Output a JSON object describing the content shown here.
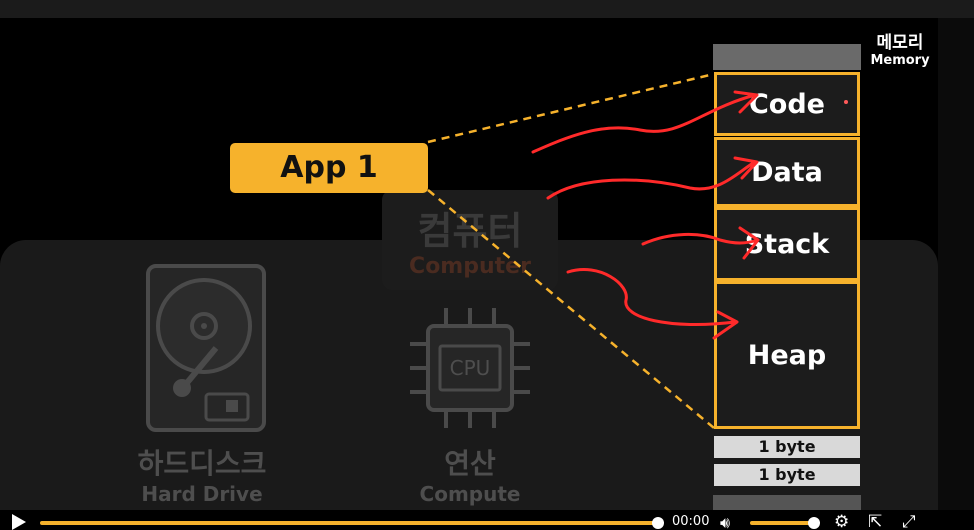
{
  "scene": {
    "computer_ko": "컴퓨터",
    "computer_en": "Computer",
    "harddisk_ko": "하드디스크",
    "harddisk_en": "Hard Drive",
    "compute_ko": "연산",
    "compute_en": "Compute",
    "cpu_chip_label": "CPU"
  },
  "app_label": "App 1",
  "memory": {
    "title_ko": "메모리",
    "title_en": "Memory",
    "segments": [
      "Code",
      "Data",
      "Stack",
      "Heap"
    ],
    "bytes": [
      "1 byte",
      "1 byte"
    ]
  },
  "player": {
    "time": "00:00",
    "progress": 1.0,
    "volume": 0.9
  },
  "colors": {
    "accent": "#f6b22c",
    "annotation": "#ff2a2a"
  },
  "icons": [
    "play-icon",
    "volume-icon",
    "settings-icon",
    "external-link-icon",
    "fullscreen-icon"
  ]
}
